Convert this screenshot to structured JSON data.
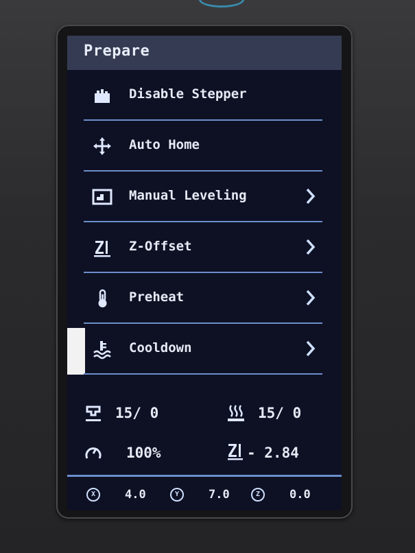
{
  "header": {
    "title": "Prepare"
  },
  "menu": [
    {
      "label": "Disable Stepper",
      "icon": "motor-icon",
      "has_submenu": false
    },
    {
      "label": "Auto Home",
      "icon": "home-arrows-icon",
      "has_submenu": false
    },
    {
      "label": "Manual Leveling",
      "icon": "leveling-icon",
      "has_submenu": true
    },
    {
      "label": "Z-Offset",
      "icon": "z-offset-icon",
      "has_submenu": true
    },
    {
      "label": "Preheat",
      "icon": "thermometer-icon",
      "has_submenu": true
    },
    {
      "label": "Cooldown",
      "icon": "cooldown-icon",
      "has_submenu": true,
      "selected": true
    }
  ],
  "status": {
    "hotend": "15/ 0",
    "bed": "15/ 0",
    "speed": "100%",
    "z_offset": "- 2.84"
  },
  "axes": {
    "x_label": "X",
    "x": "4.0",
    "y_label": "Y",
    "y": "7.0",
    "z_label": "Z",
    "z": "0.0"
  },
  "colors": {
    "screen_bg": "#0e1124",
    "title_bar": "#353b52",
    "divider": "#6c8fcc",
    "text": "#e6eaf5"
  }
}
